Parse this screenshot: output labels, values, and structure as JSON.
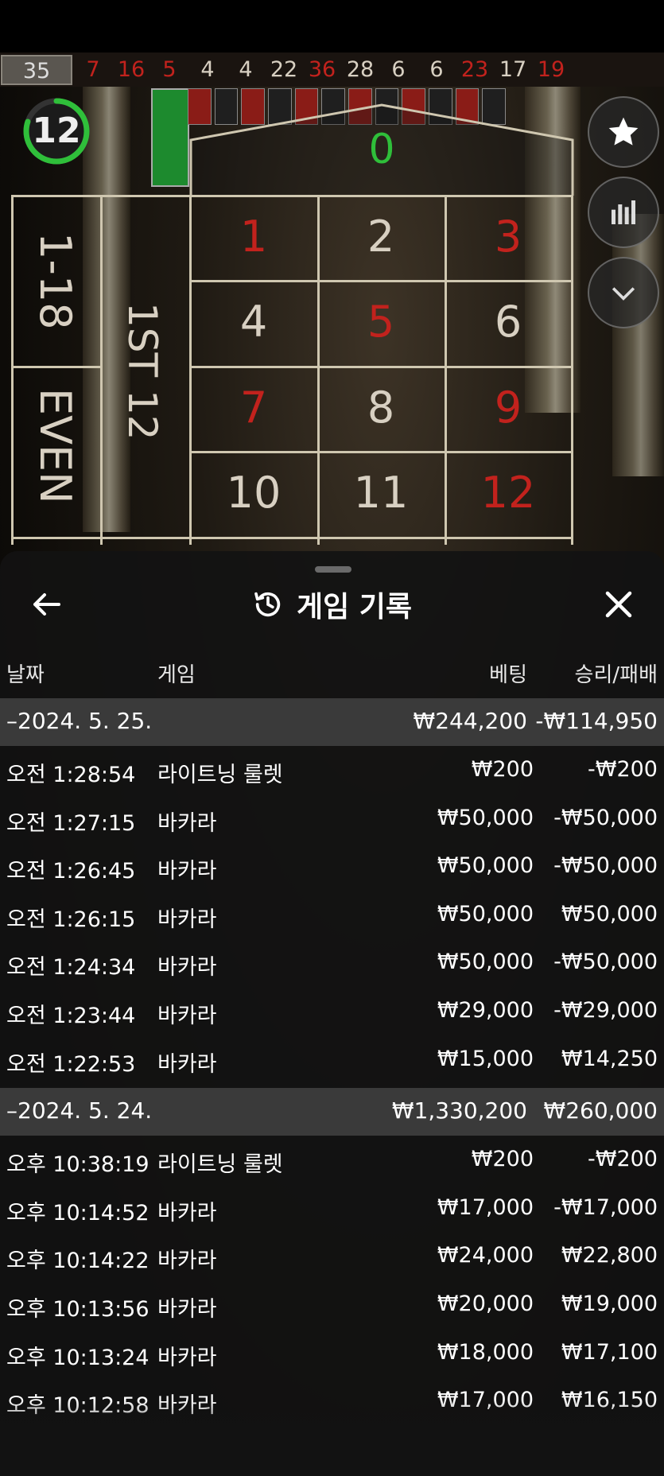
{
  "history_numbers": [
    {
      "value": "35",
      "color": "current"
    },
    {
      "value": "7",
      "color": "red"
    },
    {
      "value": "16",
      "color": "red"
    },
    {
      "value": "5",
      "color": "red"
    },
    {
      "value": "4",
      "color": "light"
    },
    {
      "value": "4",
      "color": "light"
    },
    {
      "value": "22",
      "color": "light"
    },
    {
      "value": "36",
      "color": "red"
    },
    {
      "value": "28",
      "color": "light"
    },
    {
      "value": "6",
      "color": "light"
    },
    {
      "value": "6",
      "color": "light"
    },
    {
      "value": "23",
      "color": "red"
    },
    {
      "value": "17",
      "color": "light"
    },
    {
      "value": "19",
      "color": "red"
    }
  ],
  "timer": {
    "value": "12",
    "progress": 0.8,
    "color": "#2fbf3a"
  },
  "table": {
    "zero": "0",
    "side_labels": {
      "low": "1-18",
      "even": "EVEN",
      "dozen": "1ST 12"
    },
    "numbers": [
      {
        "n": "1",
        "color": "red"
      },
      {
        "n": "2",
        "color": "light"
      },
      {
        "n": "3",
        "color": "red"
      },
      {
        "n": "4",
        "color": "light"
      },
      {
        "n": "5",
        "color": "red"
      },
      {
        "n": "6",
        "color": "light"
      },
      {
        "n": "7",
        "color": "red"
      },
      {
        "n": "8",
        "color": "light"
      },
      {
        "n": "9",
        "color": "red"
      },
      {
        "n": "10",
        "color": "light"
      },
      {
        "n": "11",
        "color": "light"
      },
      {
        "n": "12",
        "color": "red"
      }
    ]
  },
  "side_buttons": [
    "star-icon",
    "stats-icon",
    "chevron-down-icon"
  ],
  "panel": {
    "title": "게임 기록",
    "columns": {
      "date": "날짜",
      "game": "게임",
      "bet": "베팅",
      "result": "승리/패배"
    },
    "groups": [
      {
        "date": "–2024. 5. 25.",
        "bet": "₩244,200",
        "result": "-₩114,950",
        "rows": [
          {
            "time": "오전 1:28:54",
            "game": "라이트닝 룰렛",
            "bet": "₩200",
            "result": "-₩200"
          },
          {
            "time": "오전 1:27:15",
            "game": "바카라",
            "bet": "₩50,000",
            "result": "-₩50,000"
          },
          {
            "time": "오전 1:26:45",
            "game": "바카라",
            "bet": "₩50,000",
            "result": "-₩50,000"
          },
          {
            "time": "오전 1:26:15",
            "game": "바카라",
            "bet": "₩50,000",
            "result": "₩50,000"
          },
          {
            "time": "오전 1:24:34",
            "game": "바카라",
            "bet": "₩50,000",
            "result": "-₩50,000"
          },
          {
            "time": "오전 1:23:44",
            "game": "바카라",
            "bet": "₩29,000",
            "result": "-₩29,000"
          },
          {
            "time": "오전 1:22:53",
            "game": "바카라",
            "bet": "₩15,000",
            "result": "₩14,250"
          }
        ]
      },
      {
        "date": "–2024. 5. 24.",
        "bet": "₩1,330,200",
        "result": "₩260,000",
        "rows": [
          {
            "time": "오후 10:38:19",
            "game": "라이트닝 룰렛",
            "bet": "₩200",
            "result": "-₩200"
          },
          {
            "time": "오후 10:14:52",
            "game": "바카라",
            "bet": "₩17,000",
            "result": "-₩17,000"
          },
          {
            "time": "오후 10:14:22",
            "game": "바카라",
            "bet": "₩24,000",
            "result": "₩22,800"
          },
          {
            "time": "오후 10:13:56",
            "game": "바카라",
            "bet": "₩20,000",
            "result": "₩19,000"
          },
          {
            "time": "오후 10:13:24",
            "game": "바카라",
            "bet": "₩18,000",
            "result": "₩17,100"
          },
          {
            "time": "오후 10:12:58",
            "game": "바카라",
            "bet": "₩17,000",
            "result": "₩16,150"
          }
        ]
      }
    ]
  }
}
